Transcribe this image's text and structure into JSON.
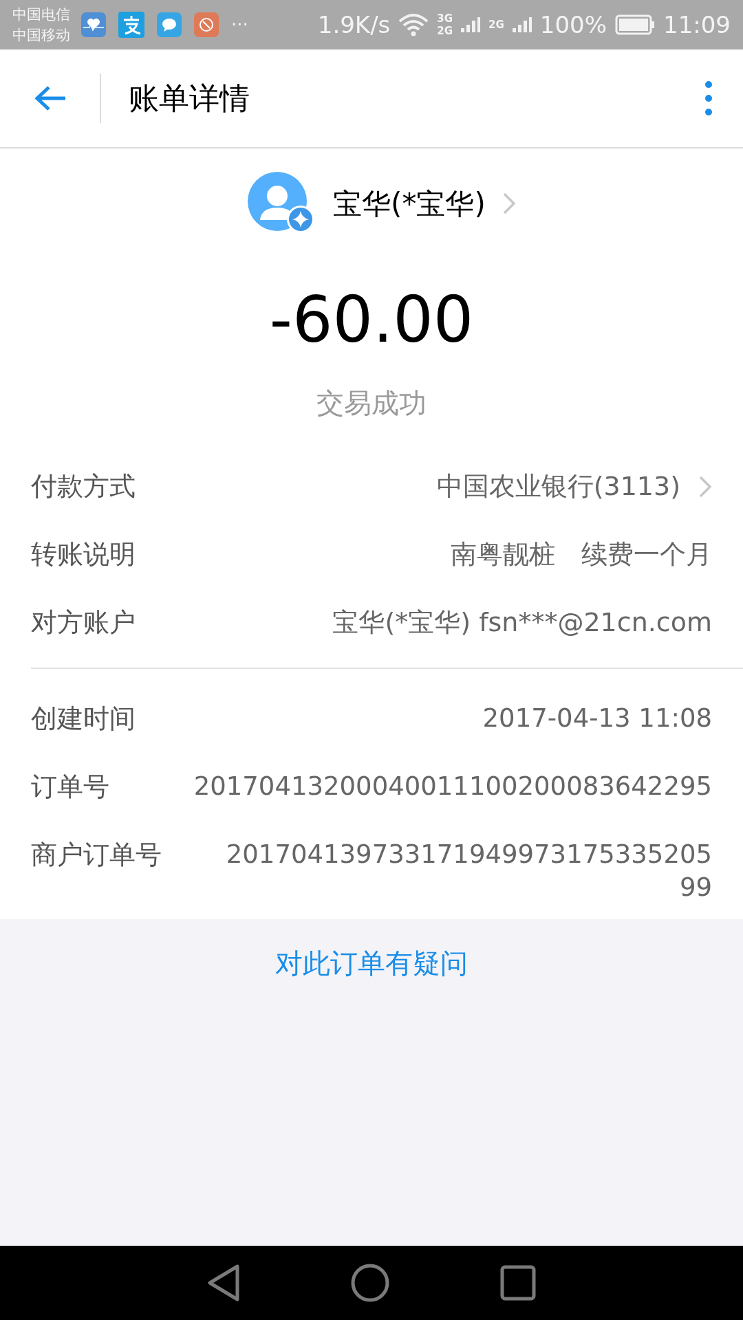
{
  "status_bar": {
    "carriers": [
      "中国电信",
      "中国移动"
    ],
    "more": "···",
    "speed": "1.9K/s",
    "network_1": "3G",
    "network_2": "2G",
    "network_3": "2G",
    "battery": "100%",
    "time": "11:09"
  },
  "header": {
    "title": "账单详情"
  },
  "payee": {
    "name": "宝华(*宝华)"
  },
  "amount": "-60.00",
  "status": "交易成功",
  "details": [
    {
      "label": "付款方式",
      "value": "中国农业银行(3113)",
      "link": true
    },
    {
      "label": "转账说明",
      "value": "南粤靓桩　续费一个月",
      "link": false
    },
    {
      "label": "对方账户",
      "value": "宝华(*宝华) fsn***@21cn.com",
      "link": false
    }
  ],
  "order_details": [
    {
      "label": "创建时间",
      "value": "2017-04-13 11:08"
    },
    {
      "label": "订单号",
      "value": "20170413200040011100200083642295"
    },
    {
      "label": "商户订单号",
      "value": "20170413973317194997317533520599"
    }
  ],
  "question_link": "对此订单有疑问"
}
